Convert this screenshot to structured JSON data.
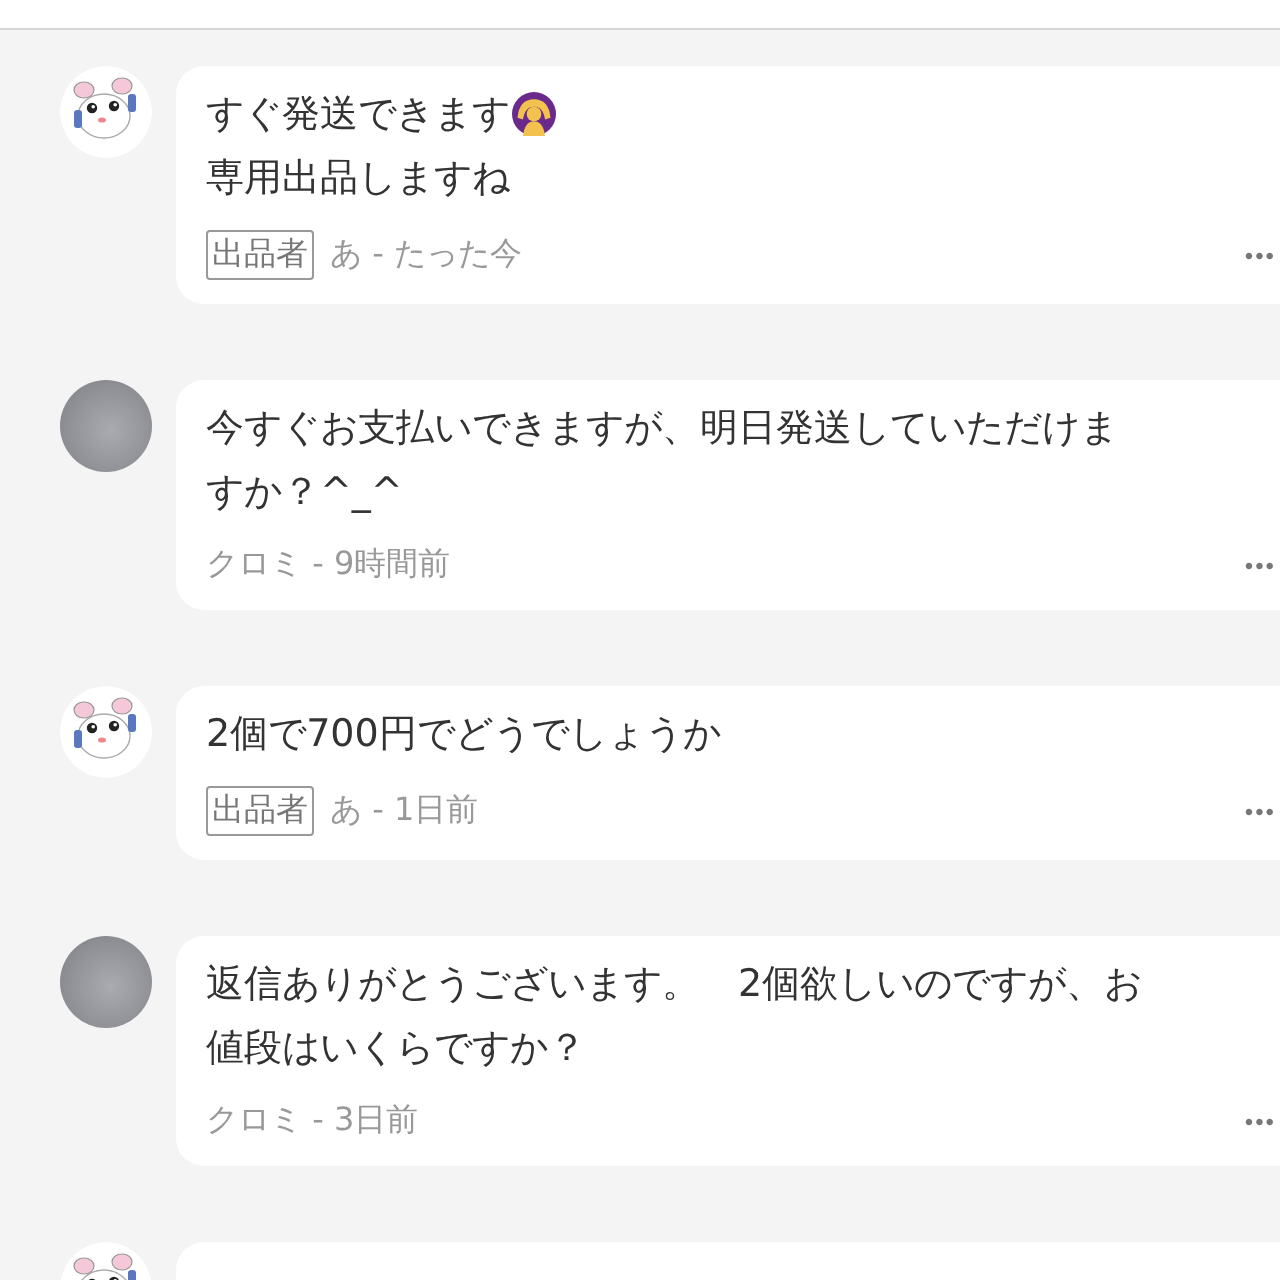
{
  "comments": [
    {
      "kind": "seller",
      "lines": [
        "すぐ発送できます",
        "専用出品しますね"
      ],
      "emoji": true,
      "badge": "出品者",
      "meta": "あ - たった今",
      "more": "•••"
    },
    {
      "kind": "buyer",
      "lines": [
        "今すぐお支払いできますが、明日発送していただけま",
        "すか？^_^"
      ],
      "meta": "クロミ - 9時間前",
      "more": "•••"
    },
    {
      "kind": "seller",
      "lines": [
        "2個で700円でどうでしょうか"
      ],
      "badge": "出品者",
      "meta": "あ - 1日前",
      "more": "•••"
    },
    {
      "kind": "buyer",
      "lines": [
        "返信ありがとうございます。　2個欲しいのですが、お",
        "値段はいくらですか？"
      ],
      "meta": "クロミ - 3日前",
      "more": "•••"
    },
    {
      "kind": "seller"
    }
  ]
}
